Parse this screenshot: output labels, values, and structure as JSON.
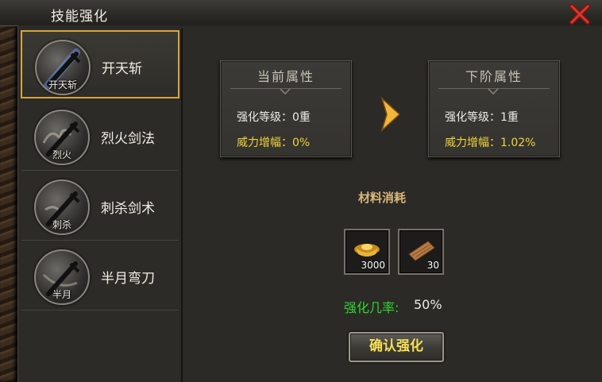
{
  "window": {
    "title": "技能强化"
  },
  "skills": [
    {
      "name": "开天斩",
      "icon_label": "开天斩",
      "selected": true
    },
    {
      "name": "烈火剑法",
      "icon_label": "烈火",
      "selected": false
    },
    {
      "name": "刺杀剑术",
      "icon_label": "刺杀",
      "selected": false
    },
    {
      "name": "半月弯刀",
      "icon_label": "半月",
      "selected": false
    }
  ],
  "current": {
    "header": "当前属性",
    "level_label": "强化等级：",
    "level_value": "0重",
    "power_label": "威力增幅：",
    "power_value": "0%"
  },
  "next": {
    "header": "下阶属性",
    "level_label": "强化等级：",
    "level_value": "1重",
    "power_label": "威力增幅：",
    "power_value": "1.02%"
  },
  "materials": {
    "title": "材料消耗",
    "items": [
      {
        "icon": "gold-ingot-icon",
        "count": "3000"
      },
      {
        "icon": "scroll-icon",
        "count": "30"
      }
    ]
  },
  "success": {
    "label": "强化几率:",
    "value": "50%"
  },
  "confirm_label": "确认强化",
  "colors": {
    "accent_gold": "#d7a43c",
    "power_yellow": "#f0d238",
    "rate_green": "#2fd52f"
  }
}
